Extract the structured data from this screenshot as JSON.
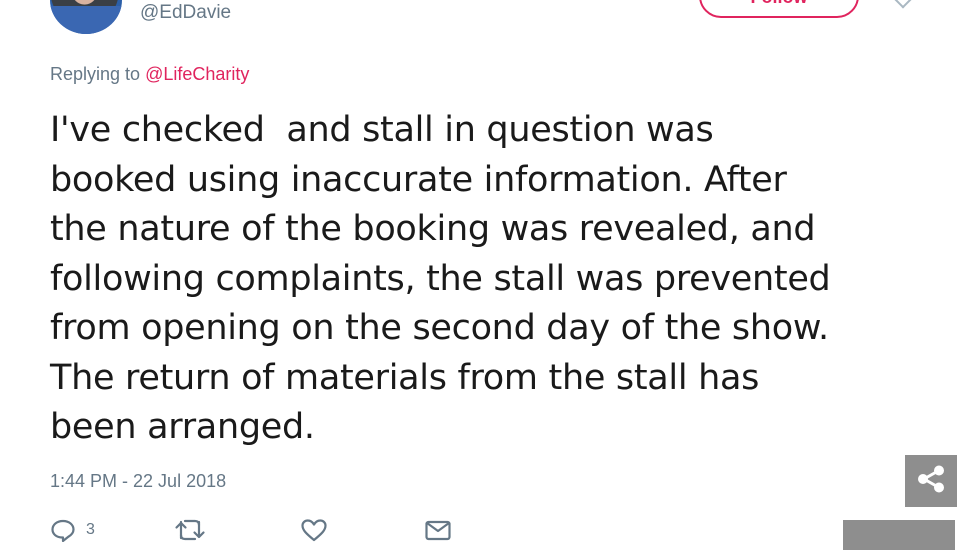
{
  "user": {
    "handle": "@EdDavie",
    "follow_label": "Follow"
  },
  "reply": {
    "prefix": "Replying to",
    "mention": "@LifeCharity"
  },
  "tweet": {
    "text": "I've checked  and stall in question was\nbooked using inaccurate information. After\nthe nature of the booking was revealed, and\nfollowing complaints, the stall was prevented\nfrom opening on the second day of the show.\nThe return of materials from the stall has\nbeen arranged.",
    "timestamp": "1:44 PM - 22 Jul 2018"
  },
  "actions": {
    "reply_count": "3",
    "icons": [
      "reply-icon",
      "retweet-icon",
      "like-icon",
      "message-icon"
    ]
  },
  "overlay": {
    "share_icon": "share-icon"
  },
  "colors": {
    "accent": "#e0245e",
    "muted": "#657786",
    "overlay": "#8e8e8e"
  }
}
